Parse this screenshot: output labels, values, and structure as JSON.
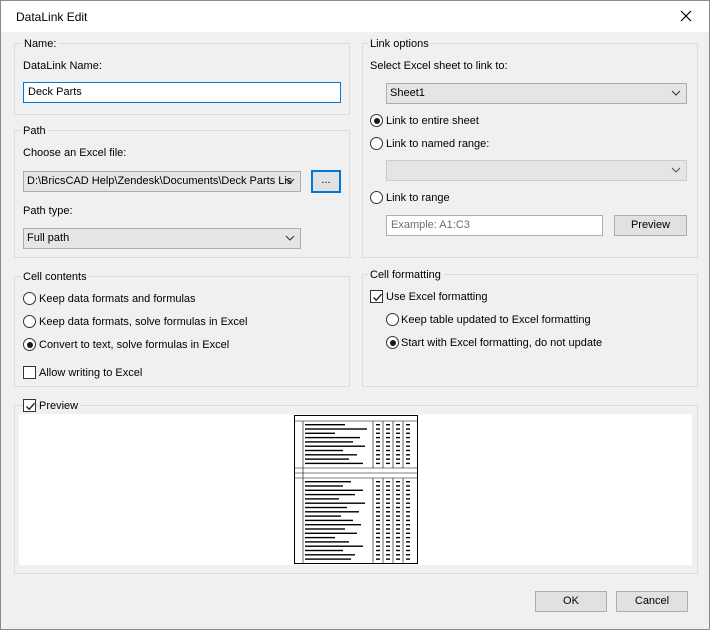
{
  "window": {
    "title": "DataLink Edit"
  },
  "name_group": {
    "legend": "Name:",
    "field_label": "DataLink Name:",
    "value": "Deck Parts"
  },
  "path_group": {
    "legend": "Path",
    "file_label": "Choose an Excel file:",
    "file_value": "D:\\BricsCAD Help\\Zendesk\\Documents\\Deck Parts Lis",
    "browse_label": "...",
    "type_label": "Path type:",
    "type_value": "Full path"
  },
  "link_group": {
    "legend": "Link options",
    "sheet_label": "Select Excel sheet to link to:",
    "sheet_value": "Sheet1",
    "entire_label": "Link to entire sheet",
    "named_label": "Link to named range:",
    "named_value": "",
    "range_label": "Link to range",
    "range_placeholder": "Example: A1:C3",
    "preview_button": "Preview",
    "selected": "entire"
  },
  "cell_contents": {
    "legend": "Cell contents",
    "option1": "Keep data formats and formulas",
    "option2": "Keep data formats, solve formulas in Excel",
    "option3": "Convert to text, solve formulas in Excel",
    "selected": 3,
    "allow_writing_label": "Allow writing to Excel",
    "allow_writing": false
  },
  "cell_formatting": {
    "legend": "Cell formatting",
    "use_excel_label": "Use Excel formatting",
    "use_excel": true,
    "keep_updated_label": "Keep table updated to Excel formatting",
    "start_with_label": "Start with Excel formatting, do not update",
    "selected": 2
  },
  "preview": {
    "label": "Preview",
    "checked": true
  },
  "buttons": {
    "ok": "OK",
    "cancel": "Cancel"
  },
  "colors": {
    "accent": "#0078d7",
    "dialog_bg": "#f0f0f0"
  }
}
